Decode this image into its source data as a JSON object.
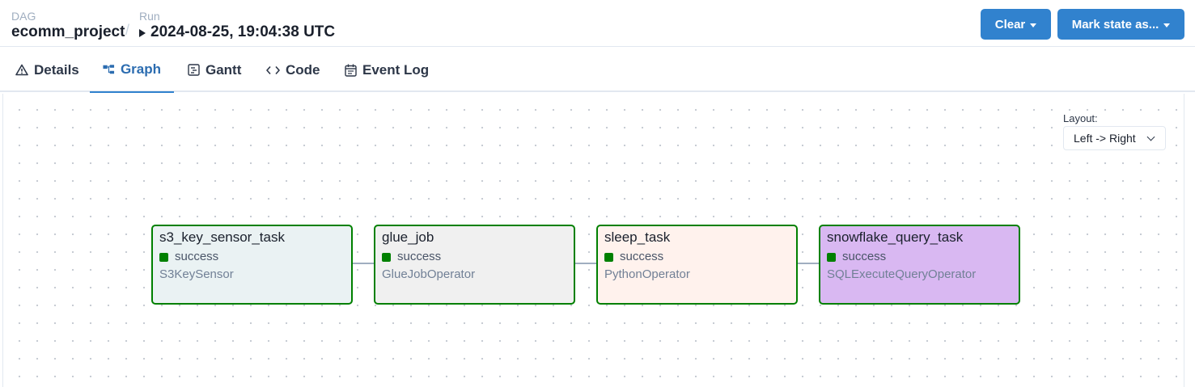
{
  "breadcrumb": {
    "dag_label": "DAG",
    "dag_name": "ecomm_project",
    "separator": "/",
    "run_label": "Run",
    "run_value": "2024-08-25, 19:04:38 UTC"
  },
  "actions": {
    "clear_label": "Clear",
    "mark_state_label": "Mark state as...",
    "button_color": "#3182ce"
  },
  "tabs": [
    {
      "label": "Details",
      "icon": "warning-triangle-icon"
    },
    {
      "label": "Graph",
      "icon": "graph-icon",
      "active": true
    },
    {
      "label": "Gantt",
      "icon": "gantt-icon"
    },
    {
      "label": "Code",
      "icon": "code-icon"
    },
    {
      "label": "Event Log",
      "icon": "calendar-icon"
    }
  ],
  "layout_control": {
    "label": "Layout:",
    "selected": "Left -> Right"
  },
  "status_colors": {
    "success": "#008000"
  },
  "nodes": [
    {
      "title": "s3_key_sensor_task",
      "status": "success",
      "operator": "S3KeySensor",
      "bg": "#eaf2f3"
    },
    {
      "title": "glue_job",
      "status": "success",
      "operator": "GlueJobOperator",
      "bg": "#f0f0f0"
    },
    {
      "title": "sleep_task",
      "status": "success",
      "operator": "PythonOperator",
      "bg": "#fff2ed"
    },
    {
      "title": "snowflake_query_task",
      "status": "success",
      "operator": "SQLExecuteQueryOperator",
      "bg": "#d9b8f2"
    }
  ]
}
